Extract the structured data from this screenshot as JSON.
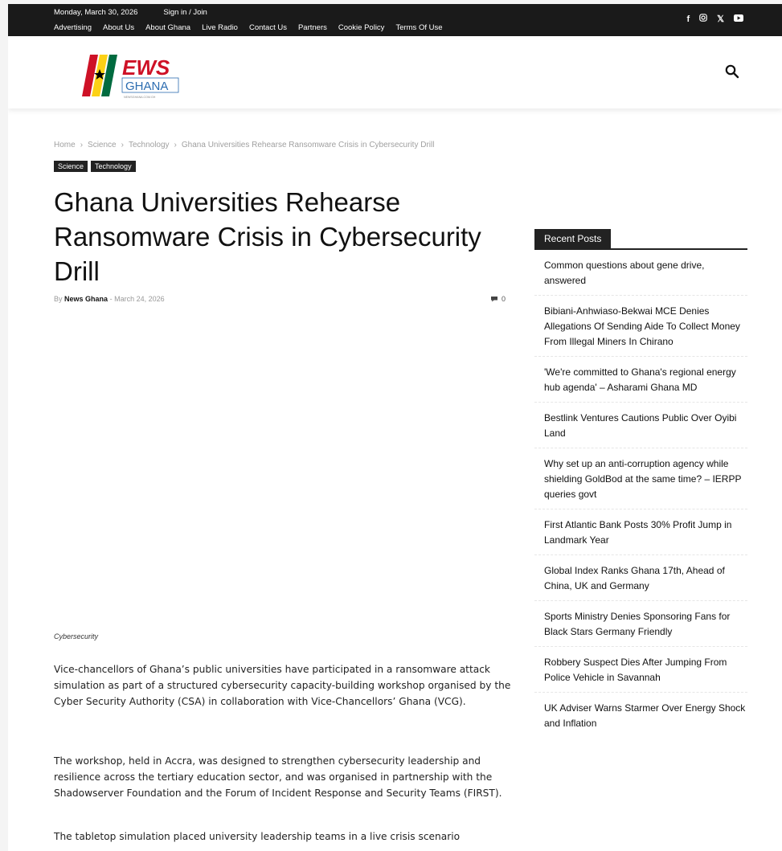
{
  "topbar": {
    "date": "Monday, March 30, 2026",
    "signin": "Sign in / Join",
    "nav": [
      "Advertising",
      "About Us",
      "About Ghana",
      "Live Radio",
      "Contact Us",
      "Partners",
      "Cookie Policy",
      "Terms Of Use"
    ],
    "social_icons": [
      "facebook-icon",
      "instagram-icon",
      "x-icon",
      "youtube-icon"
    ]
  },
  "logo": {
    "top_text": "EWS",
    "bottom_text": "GHANA",
    "tagline": "NEWSGHANA.COM.GH"
  },
  "breadcrumb": [
    "Home",
    "Science",
    "Technology",
    "Ghana Universities Rehearse Ransomware Crisis in Cybersecurity Drill"
  ],
  "breadcrumb_separator": "›",
  "categories": [
    "Science",
    "Technology"
  ],
  "article": {
    "title": "Ghana Universities Rehearse Ransomware Crisis in Cybersecurity Drill",
    "by_label": "By",
    "author": "News Ghana",
    "date_separator": "-",
    "date": "March 24, 2026",
    "comments": "0",
    "image_caption": "Cybersecurity",
    "paragraphs": [
      "Vice-chancellors of Ghana’s public universities have participated in a ransomware attack simulation as part of a structured cybersecurity capacity-building workshop organised by the Cyber Security Authority (CSA) in collaboration with Vice-Chancellors’ Ghana (VCG).",
      "The workshop, held in Accra, was designed to strengthen cybersecurity leadership and resilience across the tertiary education sector, and was organised in partnership with the Shadowserver Foundation and the Forum of Incident Response and Security Teams (FIRST).",
      "The tabletop simulation placed university leadership teams in a live crisis scenario"
    ]
  },
  "sidebar": {
    "heading": "Recent Posts",
    "posts": [
      "Common questions about gene drive, answered",
      "Bibiani-Anhwiaso-Bekwai MCE Denies Allegations Of Sending Aide To Collect Money From Illegal Miners In Chirano",
      "'We're committed to Ghana's regional energy hub agenda' – Asharami Ghana MD",
      "Bestlink Ventures Cautions Public Over Oyibi Land",
      "Why set up an anti-corruption agency while shielding GoldBod at the same time? – IERPP queries govt",
      "First Atlantic Bank Posts 30% Profit Jump in Landmark Year",
      "Global Index Ranks Ghana 17th, Ahead of China, UK and Germany",
      "Sports Ministry Denies Sponsoring Fans for Black Stars Germany Friendly",
      "Robbery Suspect Dies After Jumping From Police Vehicle in Savannah",
      "UK Adviser Warns Starmer Over Energy Shock and Inflation"
    ]
  },
  "colors": {
    "topbar_bg": "#1a1a1a",
    "category_bg": "#222222",
    "ghana_red": "#ce1126",
    "ghana_gold": "#fcd116",
    "ghana_green": "#006b3f",
    "logo_blue": "#2b6cb0"
  }
}
